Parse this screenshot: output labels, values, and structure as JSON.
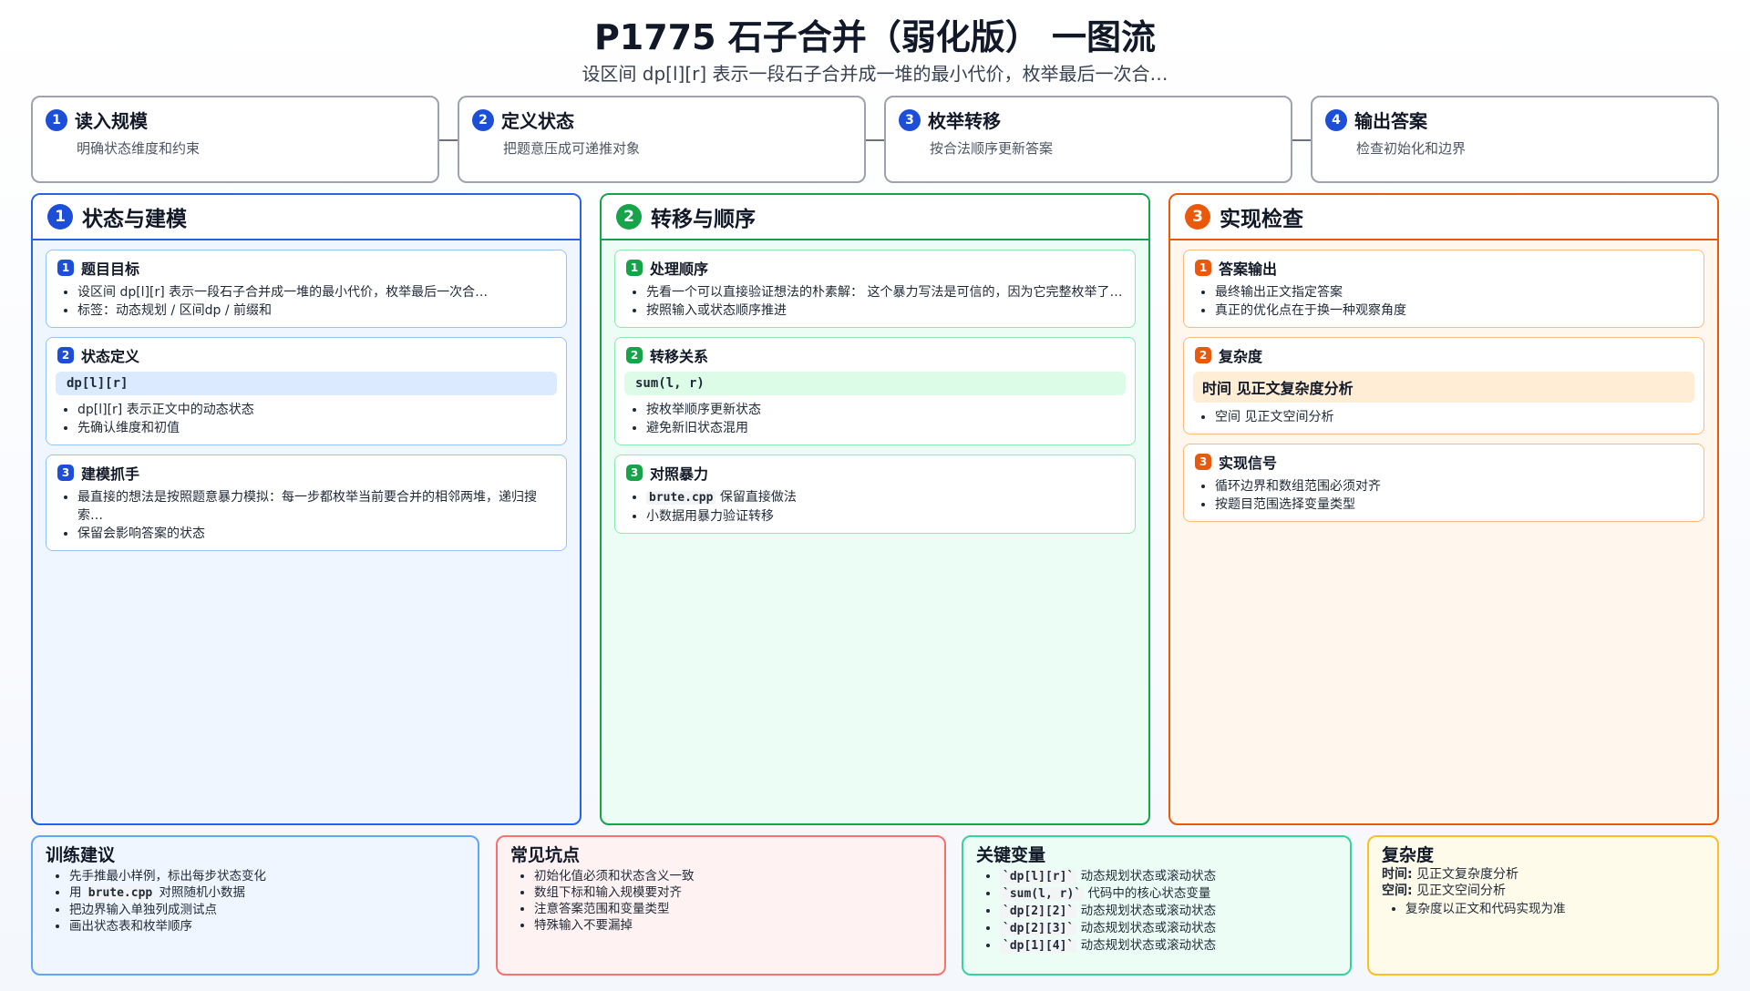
{
  "header": {
    "title": "P1775 石子合并（弱化版） 一图流",
    "subtitle": "设区间 dp[l][r] 表示一段石子合并成一堆的最小代价，枚举最后一次合…"
  },
  "steps": [
    {
      "num": "1",
      "title": "读入规模",
      "desc": "明确状态维度和约束"
    },
    {
      "num": "2",
      "title": "定义状态",
      "desc": "把题意压成可递推对象"
    },
    {
      "num": "3",
      "title": "枚举转移",
      "desc": "按合法顺序更新答案"
    },
    {
      "num": "4",
      "title": "输出答案",
      "desc": "检查初始化和边界"
    }
  ],
  "columns": {
    "modeling": {
      "num": "1",
      "title": "状态与建模",
      "cards": [
        {
          "num": "1",
          "title": "题目目标",
          "items": [
            "设区间 dp[l][r] 表示一段石子合并成一堆的最小代价，枚举最后一次合…",
            "标签：动态规划 / 区间dp / 前缀和"
          ]
        },
        {
          "num": "2",
          "title": "状态定义",
          "code": "dp[l][r]",
          "items": [
            "dp[l][r] 表示正文中的动态状态",
            "先确认维度和初值"
          ]
        },
        {
          "num": "3",
          "title": "建模抓手",
          "items": [
            "最直接的想法是按照题意暴力模拟：每一步都枚举当前要合并的相邻两堆，递归搜索…",
            "保留会影响答案的状态"
          ]
        }
      ]
    },
    "transition": {
      "num": "2",
      "title": "转移与顺序",
      "cards": [
        {
          "num": "1",
          "title": "处理顺序",
          "items": [
            "先看一个可以直接验证想法的朴素解： 这个暴力写法是可信的，因为它完整枚举了…",
            "按照输入或状态顺序推进"
          ]
        },
        {
          "num": "2",
          "title": "转移关系",
          "code": "sum(l, r)",
          "items": [
            "按枚举顺序更新状态",
            "避免新旧状态混用"
          ]
        },
        {
          "num": "3",
          "title": "对照暴力",
          "item1_code": "brute.cpp",
          "item1_text": "保留直接做法",
          "item2": "小数据用暴力验证转移"
        }
      ]
    },
    "implementation": {
      "num": "3",
      "title": "实现检查",
      "cards": [
        {
          "num": "1",
          "title": "答案输出",
          "items": [
            "最终输出正文指定答案",
            "真正的优化点在于换一种观察角度"
          ]
        },
        {
          "num": "2",
          "title": "复杂度",
          "highlight": "时间 见正文复杂度分析",
          "items": [
            "空间 见正文空间分析"
          ]
        },
        {
          "num": "3",
          "title": "实现信号",
          "items": [
            "循环边界和数组范围必须对齐",
            "按题目范围选择变量类型"
          ]
        }
      ]
    }
  },
  "bottom": {
    "training": {
      "title": "训练建议",
      "item0": "先手推最小样例，标出每步状态变化",
      "item1_prefix": "用",
      "item1_code": "brute.cpp",
      "item1_suffix": "对照随机小数据",
      "item2": "把边界输入单独列成测试点",
      "item3": "画出状态表和枚举顺序"
    },
    "pitfalls": {
      "title": "常见坑点",
      "items": [
        "初始化值必须和状态含义一致",
        "数组下标和输入规模要对齐",
        "注意答案范围和变量类型",
        "特殊输入不要漏掉"
      ]
    },
    "variables": {
      "title": "关键变量",
      "items": [
        {
          "code": "`dp[l][r]`",
          "desc": "动态规划状态或滚动状态"
        },
        {
          "code": "`sum(l, r)`",
          "desc": "代码中的核心状态变量"
        },
        {
          "code": "`dp[2][2]`",
          "desc": "动态规划状态或滚动状态"
        },
        {
          "code": "`dp[2][3]`",
          "desc": "动态规划状态或滚动状态"
        },
        {
          "code": "`dp[1][4]`",
          "desc": "动态规划状态或滚动状态"
        }
      ]
    },
    "complexity": {
      "title": "复杂度",
      "time_label": "时间:",
      "time_value": "见正文复杂度分析",
      "space_label": "空间:",
      "space_value": "见正文空间分析",
      "note": "复杂度以正文和代码实现为准"
    }
  },
  "colors": {
    "blue": "#2563eb",
    "green": "#16a34a",
    "orange": "#ea580c",
    "red": "#f87171",
    "yellow": "#fbbf24"
  }
}
